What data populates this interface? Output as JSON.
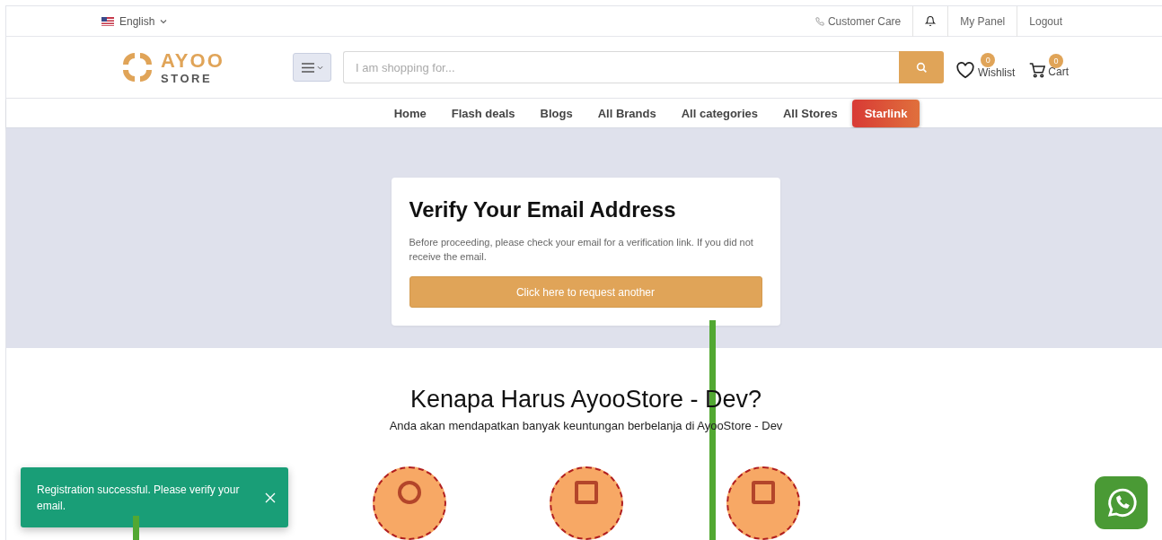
{
  "top_bar": {
    "language": "English",
    "links": [
      {
        "kind": "phone",
        "label": "Customer Care"
      },
      {
        "kind": "bell"
      },
      {
        "kind": "text",
        "label": "My Panel"
      },
      {
        "kind": "text",
        "label": "Logout"
      }
    ]
  },
  "header": {
    "logo": {
      "word": "AYOO",
      "sub": "STORE"
    },
    "search": {
      "placeholder": "I am shopping for..."
    },
    "wishlist": {
      "label": "Wishlist",
      "count": "0"
    },
    "cart": {
      "label": "Cart",
      "count": "0"
    }
  },
  "nav": [
    {
      "label": "Home",
      "highlighted": false
    },
    {
      "label": "Flash deals",
      "highlighted": false
    },
    {
      "label": "Blogs",
      "highlighted": false
    },
    {
      "label": "All Brands",
      "highlighted": false
    },
    {
      "label": "All categories",
      "highlighted": false
    },
    {
      "label": "All Stores",
      "highlighted": false
    },
    {
      "label": "Starlink",
      "highlighted": true
    }
  ],
  "verify_card": {
    "title": "Verify Your Email Address",
    "text": "Before proceeding, please check your email for a verification link. If you did not receive the email.",
    "button": "Click here to request another"
  },
  "why_section": {
    "title": "Kenapa Harus AyooStore - Dev?",
    "subtitle": "Anda akan mendapatkan banyak keuntungan berbelanja di AyooStore - Dev"
  },
  "toast": {
    "message": "Registration successful. Please verify your email."
  }
}
